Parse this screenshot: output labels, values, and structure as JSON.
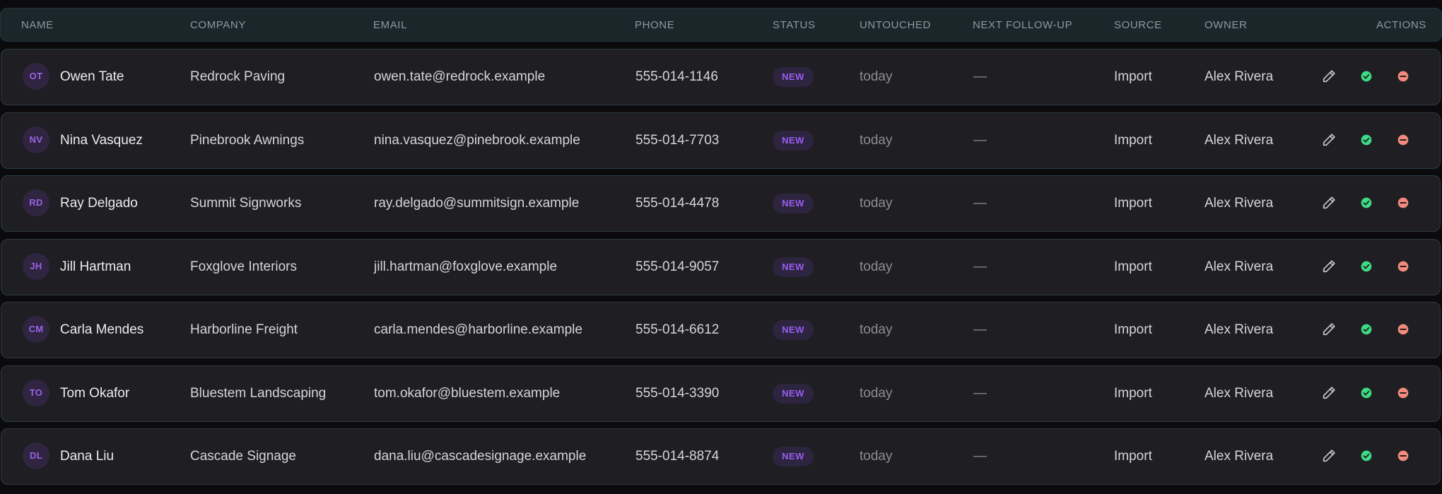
{
  "columns": {
    "name": "NAME",
    "company": "COMPANY",
    "email": "EMAIL",
    "phone": "PHONE",
    "status": "STATUS",
    "untouched": "UNTOUCHED",
    "next_follow_up": "NEXT FOLLOW-UP",
    "source": "SOURCE",
    "owner": "OWNER",
    "actions": "ACTIONS"
  },
  "rows": [
    {
      "initials": "OT",
      "name": "Owen Tate",
      "company": "Redrock Paving",
      "email": "owen.tate@redrock.example",
      "phone": "555-014-1146",
      "status": "NEW",
      "untouched": "today",
      "next_follow_up": "—",
      "source": "Import",
      "owner": "Alex Rivera"
    },
    {
      "initials": "NV",
      "name": "Nina Vasquez",
      "company": "Pinebrook Awnings",
      "email": "nina.vasquez@pinebrook.example",
      "phone": "555-014-7703",
      "status": "NEW",
      "untouched": "today",
      "next_follow_up": "—",
      "source": "Import",
      "owner": "Alex Rivera"
    },
    {
      "initials": "RD",
      "name": "Ray Delgado",
      "company": "Summit Signworks",
      "email": "ray.delgado@summitsign.example",
      "phone": "555-014-4478",
      "status": "NEW",
      "untouched": "today",
      "next_follow_up": "—",
      "source": "Import",
      "owner": "Alex Rivera"
    },
    {
      "initials": "JH",
      "name": "Jill Hartman",
      "company": "Foxglove Interiors",
      "email": "jill.hartman@foxglove.example",
      "phone": "555-014-9057",
      "status": "NEW",
      "untouched": "today",
      "next_follow_up": "—",
      "source": "Import",
      "owner": "Alex Rivera"
    },
    {
      "initials": "CM",
      "name": "Carla Mendes",
      "company": "Harborline Freight",
      "email": "carla.mendes@harborline.example",
      "phone": "555-014-6612",
      "status": "NEW",
      "untouched": "today",
      "next_follow_up": "—",
      "source": "Import",
      "owner": "Alex Rivera"
    },
    {
      "initials": "TO",
      "name": "Tom Okafor",
      "company": "Bluestem Landscaping",
      "email": "tom.okafor@bluestem.example",
      "phone": "555-014-3390",
      "status": "NEW",
      "untouched": "today",
      "next_follow_up": "—",
      "source": "Import",
      "owner": "Alex Rivera"
    },
    {
      "initials": "DL",
      "name": "Dana Liu",
      "company": "Cascade Signage",
      "email": "dana.liu@cascadesignage.example",
      "phone": "555-014-8874",
      "status": "NEW",
      "untouched": "today",
      "next_follow_up": "—",
      "source": "Import",
      "owner": "Alex Rivera"
    }
  ],
  "actions": [
    "pencil-icon",
    "check-circle-icon",
    "minus-circle-icon"
  ],
  "colors": {
    "status_new_text": "#9b5cf0",
    "check_icon": "#3ddc84",
    "remove_icon": "#f28b7d"
  }
}
